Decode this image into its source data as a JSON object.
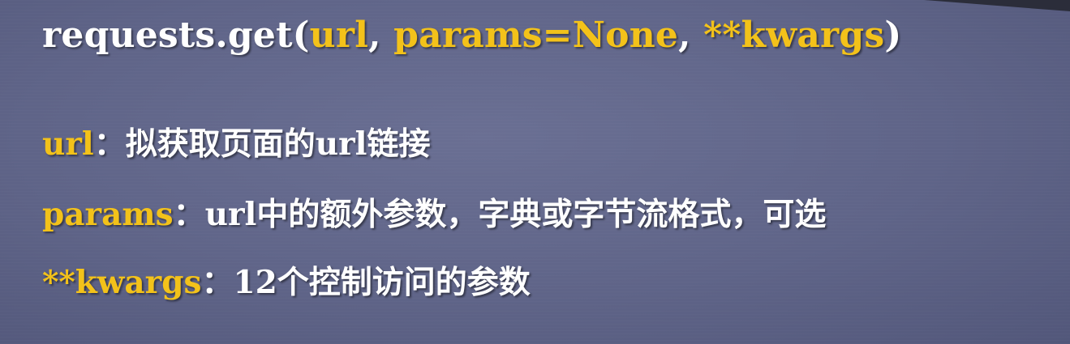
{
  "signature": {
    "func": "requests.get(",
    "arg_url": "url",
    "sep1": ", ",
    "arg_params": "params=None",
    "sep2": ", ",
    "arg_kwargs": "**kwargs",
    "close": ")"
  },
  "items": [
    {
      "name": "url",
      "colon": "：",
      "desc": "拟获取页面的url链接"
    },
    {
      "name": "params",
      "colon": "：",
      "desc": "url中的额外参数，字典或字节流格式，可选"
    },
    {
      "name": "**kwargs",
      "colon": "：",
      "desc": "12个控制访问的参数"
    }
  ],
  "colors": {
    "accent": "#f3c21a",
    "text": "#ffffff",
    "background": "#5f6488"
  }
}
